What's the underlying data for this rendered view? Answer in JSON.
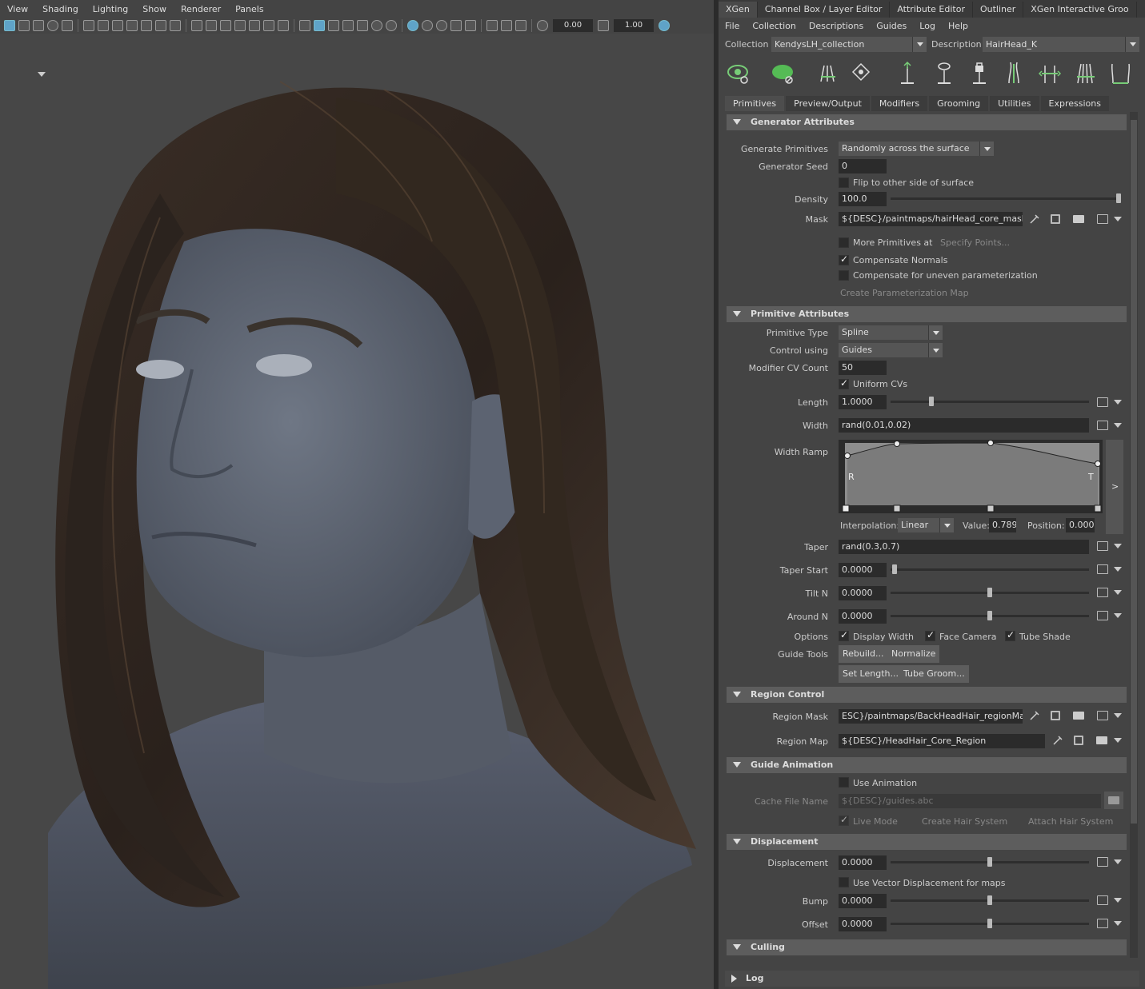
{
  "viewport": {
    "menu": [
      "View",
      "Shading",
      "Lighting",
      "Show",
      "Renderer",
      "Panels"
    ],
    "field1": "0.00",
    "field2": "1.00"
  },
  "panel": {
    "tabs": [
      "XGen",
      "Channel Box / Layer Editor",
      "Attribute Editor",
      "Outliner",
      "XGen Interactive Groo"
    ],
    "menu": [
      "File",
      "Collection",
      "Descriptions",
      "Guides",
      "Log",
      "Help"
    ],
    "collection_label": "Collection",
    "collection_value": "KendysLH_collection",
    "description_label": "Description",
    "description_value": "HairHead_K",
    "subtabs": [
      "Primitives",
      "Preview/Output",
      "Modifiers",
      "Grooming",
      "Utilities",
      "Expressions"
    ],
    "generator": {
      "title": "Generator Attributes",
      "gen_prims_label": "Generate Primitives",
      "gen_prims_value": "Randomly across the surface",
      "seed_label": "Generator Seed",
      "seed_value": "0",
      "flip_label": "Flip to other side of surface",
      "density_label": "Density",
      "density_value": "100.0",
      "mask_label": "Mask",
      "mask_value": "${DESC}/paintmaps/hairHead_core_mask",
      "more_label": "More Primitives at",
      "specify_label": "Specify Points...",
      "compnorm_label": "Compensate Normals",
      "compparam_label": "Compensate for uneven parameterization",
      "create_param_label": "Create Parameterization Map"
    },
    "primitive": {
      "title": "Primitive Attributes",
      "type_label": "Primitive Type",
      "type_value": "Spline",
      "control_label": "Control using",
      "control_value": "Guides",
      "cv_label": "Modifier CV Count",
      "cv_value": "50",
      "uniform_label": "Uniform CVs",
      "length_label": "Length",
      "length_value": "1.0000",
      "width_label": "Width",
      "width_value": "rand(0.01,0.02)",
      "ramp_label": "Width Ramp",
      "ramp_r": "R",
      "ramp_t": "T",
      "ramp_more": ">",
      "interp_label": "Interpolation:",
      "interp_value": "Linear",
      "value_label": "Value:",
      "value_value": "0.789",
      "position_label": "Position:",
      "position_value": "0.000",
      "taper_label": "Taper",
      "taper_value": "rand(0.3,0.7)",
      "taperstart_label": "Taper Start",
      "taperstart_value": "0.0000",
      "tilt_label": "Tilt N",
      "tilt_value": "0.0000",
      "around_label": "Around N",
      "around_value": "0.0000",
      "options_label": "Options",
      "displaywidth_label": "Display Width",
      "facecamera_label": "Face Camera",
      "tubeshade_label": "Tube Shade",
      "guidetools_label": "Guide Tools",
      "rebuild_label": "Rebuild...",
      "normalize_label": "Normalize",
      "setlength_label": "Set Length...",
      "tubegroom_label": "Tube Groom..."
    },
    "region": {
      "title": "Region Control",
      "mask_label": "Region Mask",
      "mask_value": "ESC}/paintmaps/BackHeadHair_regionMask",
      "map_label": "Region Map",
      "map_value": "${DESC}/HeadHair_Core_Region"
    },
    "guideanim": {
      "title": "Guide Animation",
      "use_label": "Use Animation",
      "cache_label": "Cache File Name",
      "cache_value": "${DESC}/guides.abc",
      "live_label": "Live Mode",
      "create_label": "Create Hair System",
      "attach_label": "Attach Hair System"
    },
    "displacement": {
      "title": "Displacement",
      "disp_label": "Displacement",
      "disp_value": "0.0000",
      "vector_label": "Use Vector Displacement for maps",
      "bump_label": "Bump",
      "bump_value": "0.0000",
      "offset_label": "Offset",
      "offset_value": "0.0000"
    },
    "culling": {
      "title": "Culling"
    },
    "log": "Log"
  }
}
